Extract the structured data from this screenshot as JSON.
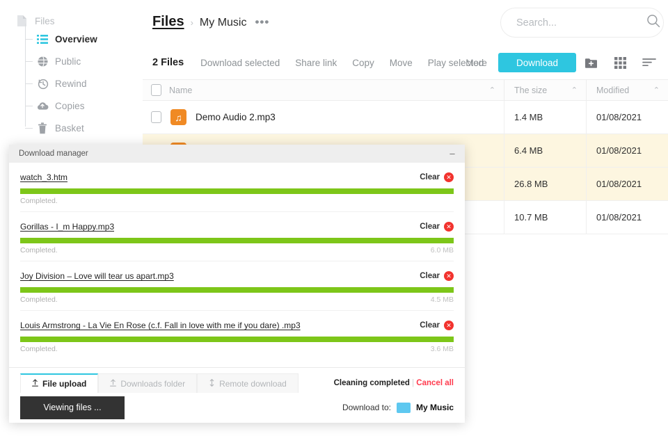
{
  "sidebar": {
    "root": {
      "label": "Files",
      "icon": "file-icon"
    },
    "items": [
      {
        "label": "Overview",
        "icon": "list-icon",
        "active": true
      },
      {
        "label": "Public",
        "icon": "globe-icon",
        "active": false
      },
      {
        "label": "Rewind",
        "icon": "history-icon",
        "active": false
      },
      {
        "label": "Copies",
        "icon": "cloud-upload-icon",
        "active": false
      },
      {
        "label": "Basket",
        "icon": "trash-icon",
        "active": false
      }
    ]
  },
  "header": {
    "breadcrumb_root": "Files",
    "breadcrumb_separator": "›",
    "breadcrumb_current": "My Music",
    "breadcrumb_more": "•••"
  },
  "search": {
    "value": "",
    "placeholder": "Search...",
    "icon": "search-icon"
  },
  "toolbar": {
    "count": "2 Files",
    "actions": [
      "Download selected",
      "Share link",
      "Copy",
      "Move",
      "Play selected"
    ],
    "more": "More",
    "download": "Download",
    "icons": [
      "new-folder-icon",
      "grid-view-icon",
      "sort-icon"
    ]
  },
  "table": {
    "columns": [
      "Name",
      "The size",
      "Modified"
    ],
    "sort_caret": "⌃",
    "rows": [
      {
        "name": "Demo Audio 2.mp3",
        "size": "1.4 MB",
        "modified": "01/08/2021",
        "selected": false,
        "checked": false,
        "icon": "audio-file-icon"
      },
      {
        "name": "",
        "size": "6.4 MB",
        "modified": "01/08/2021",
        "selected": true,
        "checked": true,
        "icon": "audio-file-icon"
      },
      {
        "name": "",
        "size": "26.8 MB",
        "modified": "01/08/2021",
        "selected": true,
        "checked": true,
        "icon": "audio-file-icon"
      },
      {
        "name": "",
        "size": "10.7 MB",
        "modified": "01/08/2021",
        "selected": false,
        "checked": false,
        "icon": "audio-file-icon"
      }
    ]
  },
  "download_manager": {
    "title": "Download manager",
    "minimize": "–",
    "clear_label": "Clear",
    "close_glyph": "✕",
    "items": [
      {
        "name": "watch_3.htm",
        "status": "Completed.",
        "size": "",
        "progress": 100
      },
      {
        "name": "Gorillas - I_m Happy.mp3",
        "status": "Completed.",
        "size": "6.0 MB",
        "progress": 100
      },
      {
        "name": "Joy Division – Love will tear us apart.mp3",
        "status": "Completed.",
        "size": "4.5 MB",
        "progress": 100
      },
      {
        "name": "Louis Armstrong - La Vie En Rose (c.f. Fall in love with me if you dare) .mp3",
        "status": "Completed.",
        "size": "3.6 MB",
        "progress": 100
      }
    ],
    "tabs": [
      {
        "label": "File upload",
        "icon": "upload-icon",
        "active": true
      },
      {
        "label": "Downloads folder",
        "icon": "upload-icon",
        "active": false
      },
      {
        "label": "Remote download",
        "icon": "transfer-icon",
        "active": false
      }
    ],
    "cleaning_status": "Cleaning completed",
    "separator": "|",
    "cancel_all": "Cancel all",
    "view_button": "Viewing files ...",
    "destination_label": "Download to:",
    "destination_name": "My Music",
    "destination_icon": "folder-icon"
  },
  "colors": {
    "accent": "#2ec6e0",
    "progress": "#7dc619",
    "danger": "#f2332e",
    "cancel": "#ff3b4e",
    "audio_icon": "#f08a24",
    "row_selected": "#fdf6e0",
    "dark_button": "#333333",
    "folder": "#5ec8f0"
  }
}
